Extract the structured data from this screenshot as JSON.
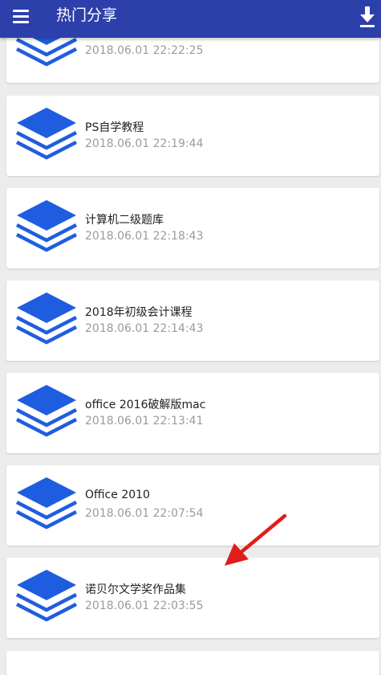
{
  "appbar": {
    "title": "热门分享"
  },
  "icons": {
    "menu": "hamburger-icon",
    "download": "download-icon",
    "item": "layers-stack-icon"
  },
  "colors": {
    "appbar": "#2d3fab",
    "icon_blue": "#1f5de0",
    "annotation_arrow": "#e21c1c",
    "background": "#ececec"
  },
  "list": {
    "items": [
      {
        "name": "",
        "date": "2018.06.01 22:22:25"
      },
      {
        "name": "PS自学教程",
        "date": "2018.06.01 22:19:44"
      },
      {
        "name": "计算机二级题库",
        "date": "2018.06.01 22:18:43"
      },
      {
        "name": "2018年初级会计课程",
        "date": "2018.06.01 22:14:43"
      },
      {
        "name": "office 2016破解版mac",
        "date": "2018.06.01 22:13:41"
      },
      {
        "name": "Office 2010",
        "date": "2018.06.01 22:07:54"
      },
      {
        "name": "诺贝尔文学奖作品集",
        "date": "2018.06.01 22:03:55"
      }
    ]
  }
}
